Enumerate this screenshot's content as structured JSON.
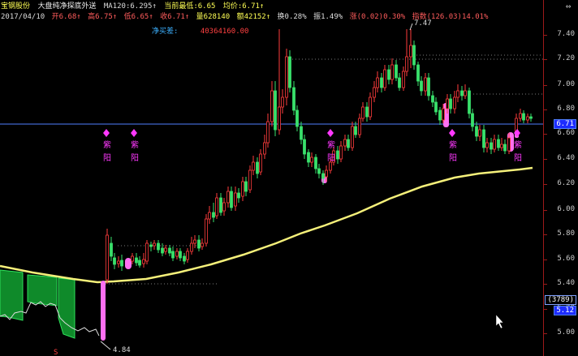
{
  "header": {
    "stock_name": "宝钢股份",
    "indicator_name": "大盘纯净探底外送",
    "ma_label": "MA120:6.295↑",
    "cur_low": "当前最低:6.65",
    "avg_price": "均价:6.71↑",
    "date": "2017/04/10",
    "open": "开6.68↑",
    "high": "高6.75↑",
    "low": "低6.65↑",
    "close": "收6.71↑",
    "volume": "量628140",
    "amount": "额42152↑",
    "turnover": "换0.28%",
    "amplitude": "振1.49%",
    "change": "涨(0.02)0.30%",
    "index": "指数(126.03)14.01%",
    "net_buy_label": "净买差:",
    "net_buy_value": "40364160.00"
  },
  "axis": {
    "ticks": [
      "7.40",
      "7.20",
      "7.00",
      "6.80",
      "6.60",
      "6.40",
      "6.20",
      "6.00",
      "5.80",
      "5.60",
      "5.40",
      "5.20",
      "5.00"
    ],
    "current_price": "6.71",
    "box_top": "(3789)",
    "box_bottom": "5.12"
  },
  "chart": {
    "high_label": "7.47",
    "low_label": "4.84",
    "signal_top": "紫",
    "signal_bottom": "阳",
    "bottom_marker": "S"
  },
  "colors": {
    "up": "#ff3d3d",
    "down": "#39e06b",
    "ma": "#f5f07a",
    "signal": "#ff38ff",
    "hline": "#4f7fff",
    "accent": "#ff4040"
  }
}
